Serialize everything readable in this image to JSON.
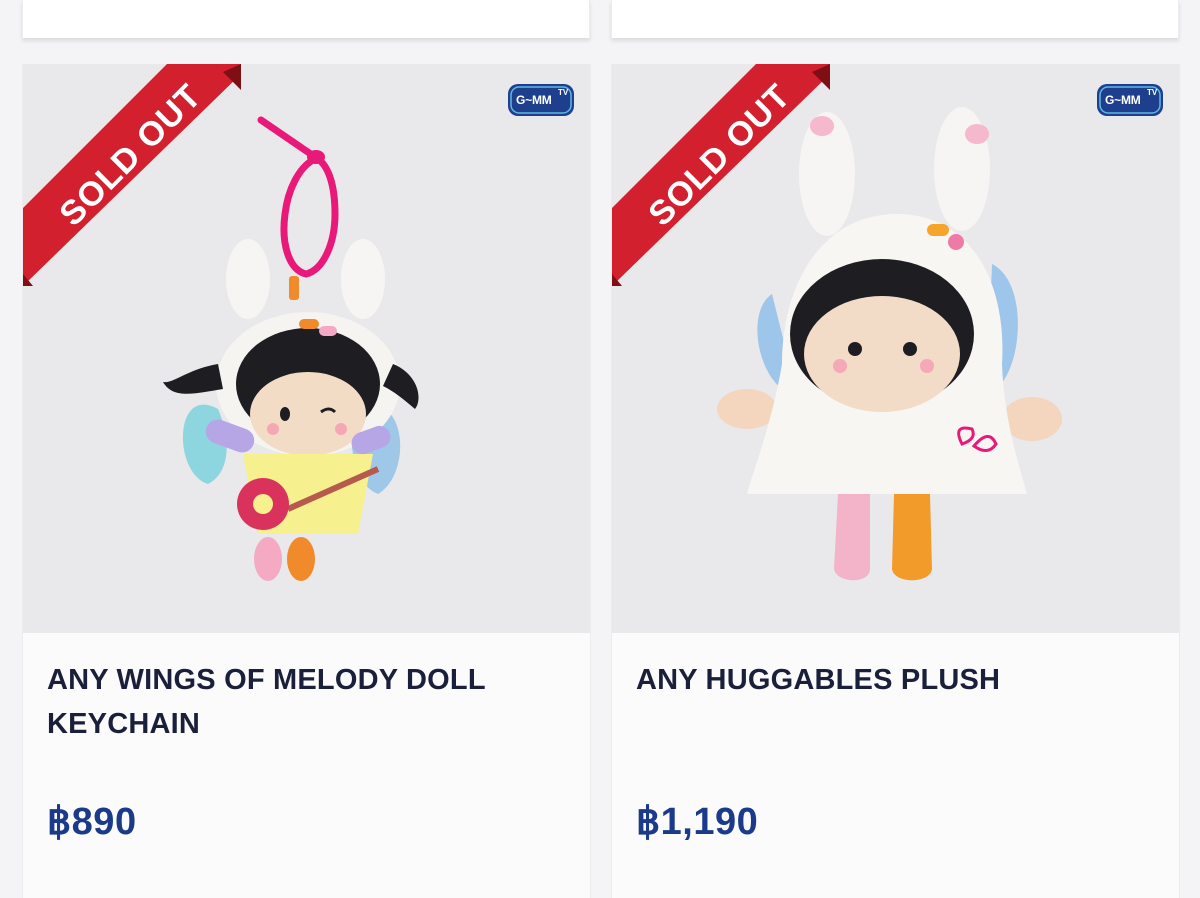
{
  "products": [
    {
      "name": "ANY WINGS OF MELODY DOLL KEYCHAIN",
      "price": "฿890",
      "badge": "SOLD OUT",
      "brand_logo": "G~MM",
      "brand_logo_tv": "TV"
    },
    {
      "name": "ANY HUGGABLES PLUSH",
      "price": "฿1,190",
      "badge": "SOLD OUT",
      "brand_logo": "G~MM",
      "brand_logo_tv": "TV"
    }
  ],
  "colors": {
    "ribbon": "#d2202e",
    "title": "#1a1f3a",
    "price": "#1b3a8a",
    "logo": "#1e3f8e"
  }
}
